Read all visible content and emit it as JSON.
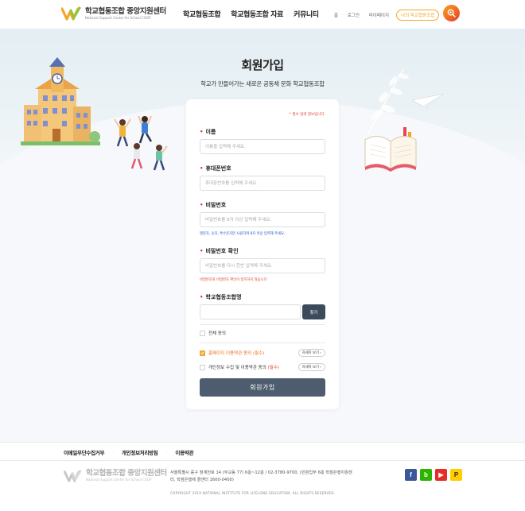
{
  "header": {
    "logo_title": "학교협동조합 중앙지원센터",
    "logo_sub": "National Support Center for School COOP",
    "nav": [
      "학교협동조합",
      "학교협동조합 자료",
      "커뮤니티"
    ],
    "util": [
      "홈",
      "로그인",
      "마이페이지"
    ],
    "my_coop": "나의 학교협동조합"
  },
  "main": {
    "title": "회원가입",
    "subtitle": "학교가 만들어가는 새로운 공동체 문화 학교협동조합",
    "required_note": "* 필수 입력 정보입니다."
  },
  "form": {
    "name_label": "이름",
    "name_placeholder": "이름을 입력해 주세요.",
    "phone_label": "휴대폰번호",
    "phone_placeholder": "휴대폰번호를 입력해 주세요.",
    "password_label": "비밀번호",
    "password_placeholder": "비밀번호를 8자 이상 입력해 주세요.",
    "password_hint": "영문자, 숫자, 특수문자만 사용하여 8자 이상 입력해 주세요.",
    "password_confirm_label": "비밀번호 확인",
    "password_confirm_placeholder": "비밀번호를 다시 한번 입력해 주세요.",
    "password_confirm_error": "비밀번호와 비밀번호 확인이 일치하지 않습니다",
    "coop_label": "학교협동조합명",
    "coop_value": "",
    "find_button": "찾기",
    "agree_all": "전체 동의",
    "agree_terms_text": "홈페이지 이용약관 동의",
    "agree_terms_req": "(필수)",
    "agree_terms_checked": true,
    "agree_privacy_text": "개인정보 수집 및 이용약관 동의",
    "agree_privacy_req": "(필수)",
    "detail_button": "자세히 보기",
    "submit": "회원가입"
  },
  "footer": {
    "links": [
      "이메일무단수집거부",
      "개인정보처리방침",
      "이용약관"
    ],
    "address": "서울특별시 중구 청계천로 14 (무교동 77) 6층~12층 / 02-3780-9700, (민원업무 6층 학점은행지원센터, 학점은행제 콜센터 1600-0400)",
    "copyright": "COPYRIGHT 2019 NATIONAL INSTITUTE FOR LIFELONG EDUCATION. ALL RIGHTS RESERVED.",
    "sns": [
      "f",
      "b",
      "▶",
      "P"
    ],
    "sns_colors": [
      "#3b5998",
      "#2db400",
      "#e52d27",
      "#ffcd00"
    ]
  }
}
